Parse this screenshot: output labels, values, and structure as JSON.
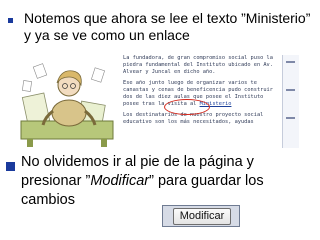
{
  "bullet1": {
    "text": "Notemos que ahora se lee el texto ”Ministerio” y ya se ve como un enlace"
  },
  "embedded_page": {
    "para1": "La fundadora, de gran compromiso social puso la piedra fundamental del Instituto ubicado en Av. Alvear y Juncal en dicho año.",
    "para2_before": "Ese año junto luego de organizar varios te canastas y cenas de beneficencia pudo construir dos de las diez aulas que posee el Instituto posee tras la visita al",
    "link_text": "Ministerio",
    "para3": "Los destinatarios de nuestro proyecto social educativo son los más necesitados, ayudas"
  },
  "bullet2": {
    "text_before": "No olvidemos ir al pie de la página y presionar ”",
    "emphasis": "Modificar",
    "text_after": "” para guardar los cambios"
  },
  "button": {
    "label": "Modificar"
  },
  "colors": {
    "bullet": "#1a3a9c",
    "link": "#1a3f9a",
    "highlight_ring": "#d32a1e"
  }
}
